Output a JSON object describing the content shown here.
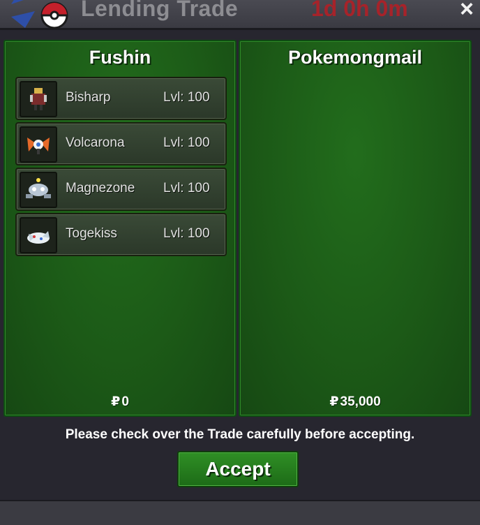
{
  "window": {
    "title": "Lending Trade",
    "timer": "1d 0h 0m",
    "close_label": "×"
  },
  "left_panel": {
    "player_name": "Fushin",
    "items": [
      {
        "name": "Bisharp",
        "level": "Lvl: 100",
        "icon": "bisharp-sprite-icon"
      },
      {
        "name": "Volcarona",
        "level": "Lvl: 100",
        "icon": "volcarona-sprite-icon"
      },
      {
        "name": "Magnezone",
        "level": "Lvl: 100",
        "icon": "magnezone-sprite-icon"
      },
      {
        "name": "Togekiss",
        "level": "Lvl: 100",
        "icon": "togekiss-sprite-icon"
      }
    ],
    "money_symbol": "₽",
    "money": "0"
  },
  "right_panel": {
    "player_name": "Pokemongmail",
    "items": [],
    "money_symbol": "₽",
    "money": "35,000"
  },
  "footer": {
    "notice": "Please check over the Trade carefully before accepting.",
    "accept_label": "Accept"
  },
  "colors": {
    "panel_green": "#1c5a17",
    "accept_green": "#2f8f25",
    "timer_red": "#a6232a",
    "background": "#27262f"
  }
}
